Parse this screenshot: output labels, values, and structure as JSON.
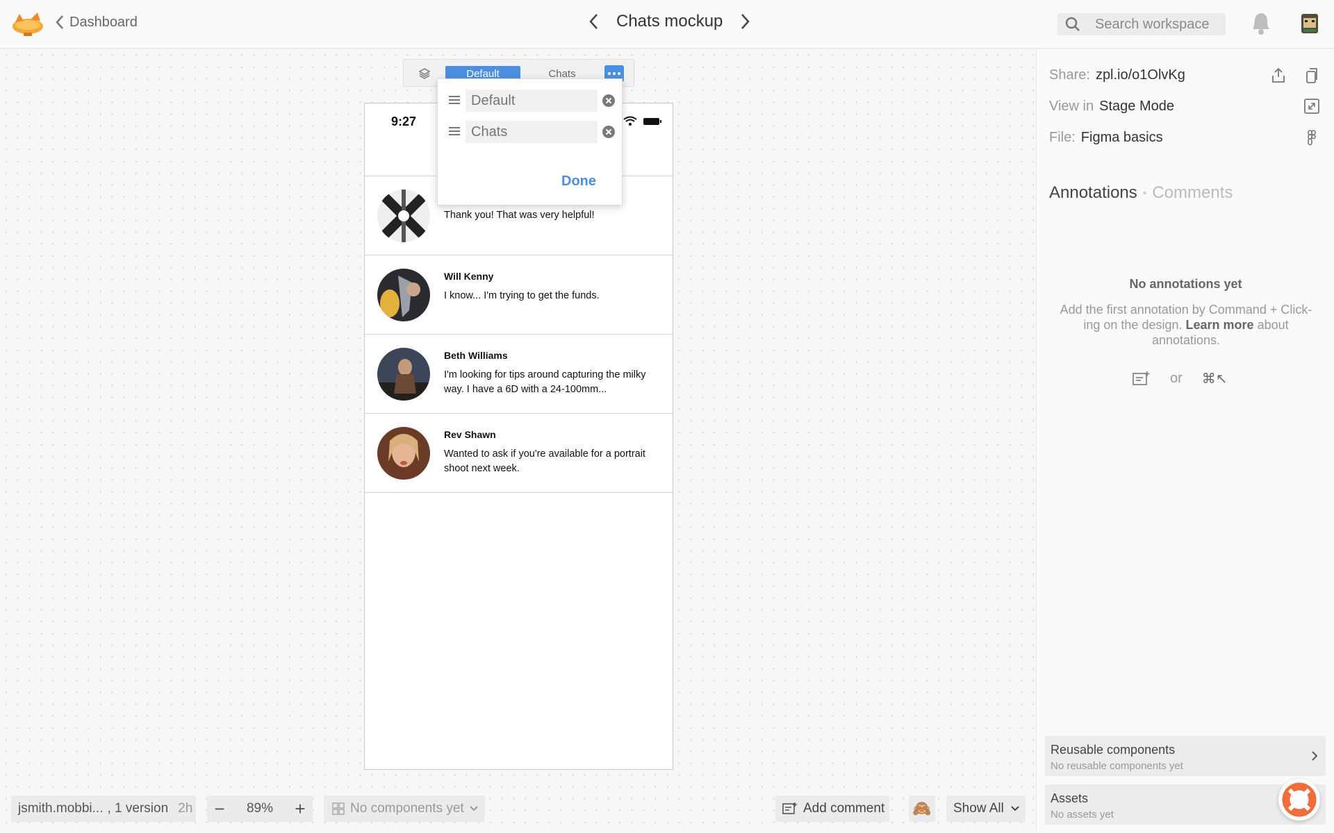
{
  "topbar": {
    "back_label": "Dashboard",
    "title": "Chats mockup",
    "search_placeholder": "Search workspace"
  },
  "frame_toolbar": {
    "tabs": [
      {
        "label": "Default",
        "active": true
      },
      {
        "label": "Chats",
        "active": false
      }
    ]
  },
  "popup": {
    "rows": [
      {
        "placeholder": "Default"
      },
      {
        "placeholder": "Chats"
      }
    ],
    "done_label": "Done"
  },
  "phone": {
    "time": "9:27",
    "chats": [
      {
        "name": "",
        "message": "Thank you! That was very helpful!"
      },
      {
        "name": "Will Kenny",
        "message": "I know... I'm trying to get the funds."
      },
      {
        "name": "Beth Williams",
        "message": "I'm looking for tips around capturing the milky way. I have a 6D with a 24-100mm..."
      },
      {
        "name": "Rev Shawn",
        "message": "Wanted to ask if you're available for a portrait shoot next week."
      }
    ]
  },
  "bottom": {
    "author": "jsmith.mobbi...",
    "versions": ", 1 version",
    "ago": "2h",
    "zoom_minus": "−",
    "zoom": "89%",
    "zoom_plus": "+",
    "components": "No components yet",
    "add_comment": "Add comment",
    "emoji": "🙈",
    "show_all": "Show All"
  },
  "panel": {
    "share_label": "Share:",
    "share_value": "zpl.io/o1OlvKg",
    "view_label": "View in",
    "view_value": "Stage Mode",
    "file_label": "File:",
    "file_value": "Figma basics",
    "tab_annotations": "Annotations",
    "tab_comments": "Comments",
    "no_annotations": "No annotations yet",
    "help_before": "Add the first annotation by Command + Click-ing on the design.",
    "help_link": "Learn more",
    "help_after": "about annotations.",
    "or": "or",
    "shortcut": "⌘↖",
    "reusable_title": "Reusable components",
    "reusable_sub": "No reusable components yet",
    "assets_title": "Assets",
    "assets_sub": "No assets yet"
  },
  "colors": {
    "accent": "#4a90e2",
    "canvas_dots": "#cfcfcf"
  }
}
